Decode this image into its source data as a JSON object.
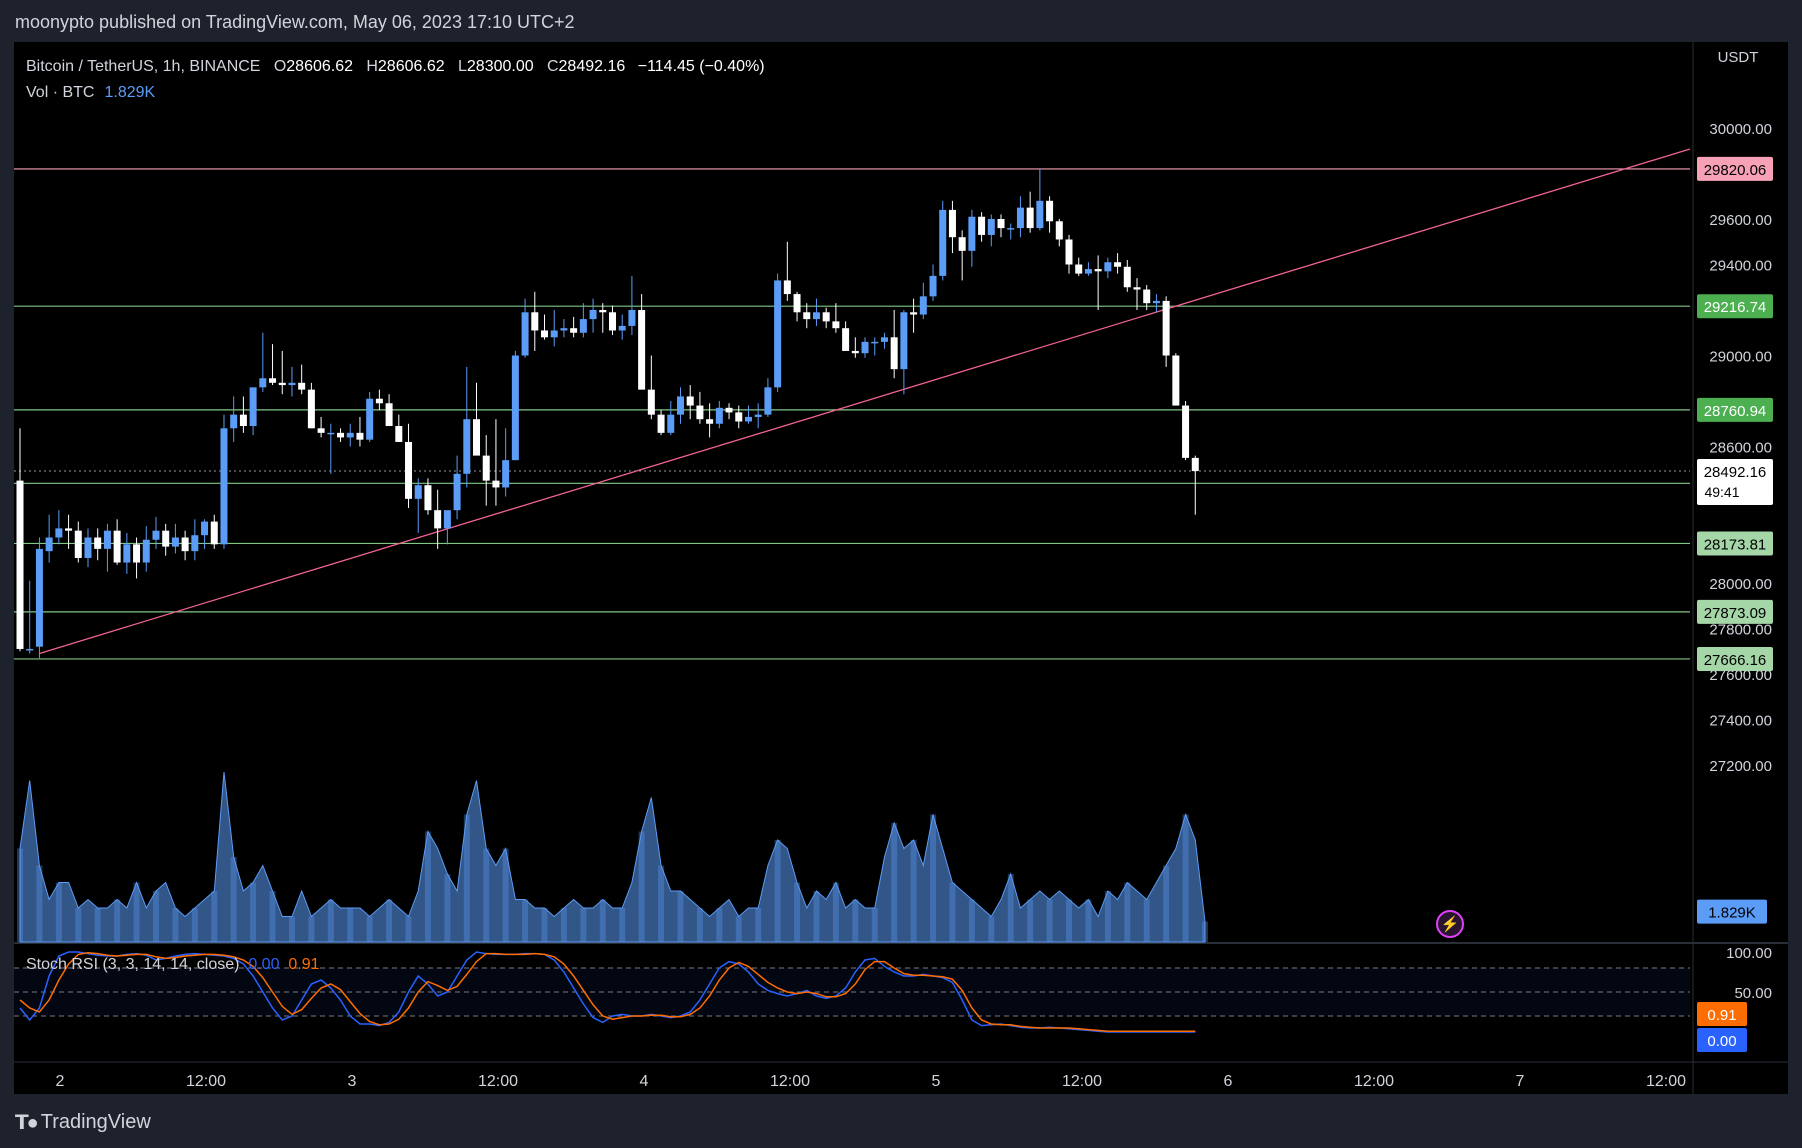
{
  "header": {
    "publisher_line": "moonypto published on TradingView.com, May 06, 2023 17:10 UTC+2"
  },
  "legend": {
    "symbol": "Bitcoin / TetherUS, 1h, BINANCE",
    "open_label": "O",
    "open": "28606.62",
    "high_label": "H",
    "high": "28606.62",
    "low_label": "L",
    "low": "28300.00",
    "close_label": "C",
    "close": "28492.16",
    "change": "−114.45 (−0.40%)",
    "volume_label": "Vol · BTC",
    "volume": "1.829K"
  },
  "stoch_rsi": {
    "label": "Stoch RSI (3, 3, 14, 14, close)",
    "k": "0.00",
    "d": "0.91"
  },
  "footer": {
    "brand": "TradingView"
  },
  "colors": {
    "up": "#5b9cf6",
    "down": "#ffffff",
    "volume": "#5b9cf6",
    "resistance": "#f7a1b6",
    "support": "#81c784",
    "trendline": "#f06292",
    "k_line": "#2962ff",
    "d_line": "#ff6d00"
  },
  "chart_data": [
    {
      "type": "candlestick",
      "y_axis_unit": "USDT",
      "y_ticks": [
        30000,
        29600,
        29400,
        29000,
        28600,
        28000,
        27800,
        27600,
        27400,
        27200
      ],
      "ylim": [
        27000,
        30100
      ],
      "x_ticks": [
        "2",
        "12:00",
        "3",
        "12:00",
        "4",
        "12:00",
        "5",
        "12:00",
        "6",
        "12:00",
        "7",
        "12:00"
      ],
      "candles_ohlc": [
        [
          28450,
          28680,
          27700,
          27710
        ],
        [
          27710,
          28010,
          27690,
          27710
        ],
        [
          27720,
          28200,
          27670,
          28150
        ],
        [
          28140,
          28300,
          28090,
          28200
        ],
        [
          28200,
          28320,
          28170,
          28240
        ],
        [
          28240,
          28300,
          28150,
          28230
        ],
        [
          28230,
          28270,
          28090,
          28110
        ],
        [
          28110,
          28240,
          28070,
          28200
        ],
        [
          28200,
          28240,
          28100,
          28150
        ],
        [
          28150,
          28260,
          28050,
          28230
        ],
        [
          28230,
          28280,
          28080,
          28090
        ],
        [
          28090,
          28220,
          28040,
          28170
        ],
        [
          28170,
          28200,
          28020,
          28090
        ],
        [
          28090,
          28250,
          28050,
          28190
        ],
        [
          28190,
          28290,
          28150,
          28230
        ],
        [
          28230,
          28260,
          28120,
          28160
        ],
        [
          28160,
          28260,
          28130,
          28200
        ],
        [
          28200,
          28230,
          28100,
          28140
        ],
        [
          28140,
          28280,
          28100,
          28210
        ],
        [
          28210,
          28280,
          28150,
          28270
        ],
        [
          28270,
          28300,
          28150,
          28170
        ],
        [
          28170,
          28740,
          28150,
          28680
        ],
        [
          28680,
          28820,
          28620,
          28740
        ],
        [
          28740,
          28820,
          28660,
          28690
        ],
        [
          28690,
          28840,
          28650,
          28860
        ],
        [
          28860,
          29100,
          28840,
          28900
        ],
        [
          28900,
          29050,
          28870,
          28880
        ],
        [
          28880,
          29020,
          28830,
          28870
        ],
        [
          28870,
          28950,
          28820,
          28880
        ],
        [
          28880,
          28960,
          28830,
          28850
        ],
        [
          28850,
          28880,
          28680,
          28680
        ],
        [
          28680,
          28730,
          28640,
          28660
        ],
        [
          28660,
          28700,
          28480,
          28660
        ],
        [
          28660,
          28680,
          28620,
          28640
        ],
        [
          28640,
          28700,
          28600,
          28660
        ],
        [
          28660,
          28730,
          28600,
          28630
        ],
        [
          28630,
          28840,
          28620,
          28810
        ],
        [
          28810,
          28850,
          28760,
          28790
        ],
        [
          28790,
          28830,
          28700,
          28690
        ],
        [
          28690,
          28740,
          28650,
          28620
        ],
        [
          28620,
          28700,
          28330,
          28370
        ],
        [
          28370,
          28460,
          28220,
          28430
        ],
        [
          28430,
          28460,
          28300,
          28320
        ],
        [
          28320,
          28410,
          28150,
          28240
        ],
        [
          28240,
          28300,
          28170,
          28320
        ],
        [
          28320,
          28560,
          28280,
          28480
        ],
        [
          28480,
          28950,
          28420,
          28720
        ],
        [
          28720,
          28880,
          28620,
          28560
        ],
        [
          28560,
          28650,
          28340,
          28450
        ],
        [
          28450,
          28720,
          28340,
          28420
        ],
        [
          28420,
          28680,
          28380,
          28540
        ],
        [
          28540,
          29020,
          28540,
          29000
        ],
        [
          29000,
          29250,
          28990,
          29190
        ],
        [
          29190,
          29280,
          29020,
          29110
        ],
        [
          29110,
          29180,
          29070,
          29080
        ],
        [
          29080,
          29200,
          29040,
          29110
        ],
        [
          29110,
          29160,
          29080,
          29120
        ],
        [
          29120,
          29170,
          29080,
          29100
        ],
        [
          29100,
          29230,
          29080,
          29160
        ],
        [
          29160,
          29250,
          29100,
          29200
        ],
        [
          29200,
          29230,
          29100,
          29190
        ],
        [
          29190,
          29220,
          29090,
          29110
        ],
        [
          29110,
          29180,
          29070,
          29130
        ],
        [
          29130,
          29350,
          29090,
          29200
        ],
        [
          29200,
          29270,
          29050,
          28850
        ],
        [
          28850,
          29000,
          28720,
          28740
        ],
        [
          28740,
          28760,
          28650,
          28660
        ],
        [
          28660,
          28800,
          28650,
          28740
        ],
        [
          28740,
          28860,
          28700,
          28820
        ],
        [
          28820,
          28870,
          28720,
          28780
        ],
        [
          28780,
          28840,
          28700,
          28720
        ],
        [
          28720,
          28790,
          28640,
          28700
        ],
        [
          28700,
          28800,
          28680,
          28770
        ],
        [
          28770,
          28790,
          28720,
          28750
        ],
        [
          28750,
          28780,
          28680,
          28710
        ],
        [
          28710,
          28780,
          28700,
          28730
        ],
        [
          28730,
          28790,
          28680,
          28740
        ],
        [
          28740,
          28900,
          28730,
          28860
        ],
        [
          28860,
          29360,
          28840,
          29330
        ],
        [
          29330,
          29500,
          29240,
          29270
        ],
        [
          29270,
          29280,
          29150,
          29190
        ],
        [
          29190,
          29230,
          29120,
          29160
        ],
        [
          29160,
          29250,
          29130,
          29190
        ],
        [
          29190,
          29210,
          29120,
          29150
        ],
        [
          29150,
          29230,
          29100,
          29120
        ],
        [
          29120,
          29150,
          29030,
          29020
        ],
        [
          29020,
          29080,
          28990,
          29010
        ],
        [
          29010,
          29080,
          28990,
          29060
        ],
        [
          29060,
          29080,
          29000,
          29060
        ],
        [
          29060,
          29100,
          29030,
          29080
        ],
        [
          29080,
          29200,
          28900,
          28940
        ],
        [
          28940,
          29200,
          28830,
          29190
        ],
        [
          29190,
          29250,
          29100,
          29180
        ],
        [
          29180,
          29320,
          29160,
          29260
        ],
        [
          29260,
          29400,
          29240,
          29350
        ],
        [
          29350,
          29680,
          29330,
          29640
        ],
        [
          29640,
          29680,
          29450,
          29520
        ],
        [
          29520,
          29550,
          29330,
          29460
        ],
        [
          29460,
          29640,
          29390,
          29610
        ],
        [
          29610,
          29630,
          29500,
          29530
        ],
        [
          29530,
          29620,
          29480,
          29600
        ],
        [
          29600,
          29620,
          29520,
          29560
        ],
        [
          29560,
          29580,
          29510,
          29560
        ],
        [
          29560,
          29700,
          29520,
          29650
        ],
        [
          29650,
          29720,
          29540,
          29560
        ],
        [
          29560,
          29820,
          29550,
          29680
        ],
        [
          29680,
          29700,
          29540,
          29590
        ],
        [
          29590,
          29600,
          29480,
          29510
        ],
        [
          29510,
          29530,
          29360,
          29400
        ],
        [
          29400,
          29430,
          29350,
          29360
        ],
        [
          29360,
          29410,
          29350,
          29380
        ],
        [
          29380,
          29440,
          29200,
          29370
        ],
        [
          29370,
          29430,
          29340,
          29410
        ],
        [
          29410,
          29450,
          29360,
          29390
        ],
        [
          29390,
          29420,
          29280,
          29300
        ],
        [
          29300,
          29340,
          29200,
          29290
        ],
        [
          29290,
          29310,
          29200,
          29230
        ],
        [
          29230,
          29270,
          29190,
          29240
        ],
        [
          29240,
          29260,
          28950,
          29000
        ],
        [
          29000,
          29010,
          28780,
          28780
        ],
        [
          28780,
          28800,
          28540,
          28550
        ],
        [
          28550,
          28560,
          28300,
          28492
        ]
      ],
      "volume": [
        0.55,
        0.95,
        0.45,
        0.25,
        0.35,
        0.35,
        0.2,
        0.25,
        0.2,
        0.2,
        0.25,
        0.2,
        0.35,
        0.2,
        0.3,
        0.35,
        0.2,
        0.15,
        0.2,
        0.25,
        0.3,
        1.0,
        0.5,
        0.3,
        0.35,
        0.45,
        0.3,
        0.15,
        0.15,
        0.3,
        0.15,
        0.2,
        0.25,
        0.2,
        0.2,
        0.2,
        0.15,
        0.2,
        0.25,
        0.2,
        0.15,
        0.3,
        0.65,
        0.55,
        0.4,
        0.3,
        0.75,
        0.95,
        0.55,
        0.45,
        0.55,
        0.25,
        0.25,
        0.2,
        0.2,
        0.15,
        0.2,
        0.25,
        0.2,
        0.2,
        0.25,
        0.2,
        0.2,
        0.35,
        0.65,
        0.85,
        0.45,
        0.3,
        0.3,
        0.25,
        0.2,
        0.15,
        0.2,
        0.25,
        0.15,
        0.2,
        0.2,
        0.45,
        0.6,
        0.55,
        0.35,
        0.2,
        0.3,
        0.25,
        0.35,
        0.2,
        0.25,
        0.2,
        0.2,
        0.5,
        0.7,
        0.55,
        0.6,
        0.45,
        0.75,
        0.55,
        0.35,
        0.3,
        0.25,
        0.2,
        0.15,
        0.25,
        0.4,
        0.2,
        0.25,
        0.3,
        0.25,
        0.3,
        0.25,
        0.2,
        0.25,
        0.15,
        0.3,
        0.25,
        0.35,
        0.3,
        0.25,
        0.35,
        0.45,
        0.55,
        0.75,
        0.6,
        0.12
      ],
      "levels": [
        {
          "label": "29820.06",
          "value": 29820.06,
          "kind": "resistance"
        },
        {
          "label": "29216.74",
          "value": 29216.74,
          "kind": "support"
        },
        {
          "label": "28760.94",
          "value": 28760.94,
          "kind": "support"
        },
        {
          "label": "28438.25",
          "value": 28438.25,
          "kind": "support"
        },
        {
          "label": "28173.81",
          "value": 28173.81,
          "kind": "support"
        },
        {
          "label": "27873.09",
          "value": 27873.09,
          "kind": "support"
        },
        {
          "label": "27666.16",
          "value": 27666.16,
          "kind": "support"
        }
      ],
      "current_price": {
        "label": "28492.16",
        "value": 28492.16,
        "countdown": "49:41"
      },
      "volume_last_label": "1.829K",
      "trendline": {
        "start_index": 2,
        "start_value": 27690,
        "end_index": 120,
        "end_value": 29230
      }
    },
    {
      "type": "line",
      "title": "Stoch RSI (3, 3, 14, 14, close)",
      "ylim": [
        0,
        100
      ],
      "y_ticks": [
        "100.00",
        "50.00"
      ],
      "bands": [
        80,
        50,
        20
      ],
      "k_label": "0.00",
      "d_label": "0.91",
      "series": [
        {
          "name": "K",
          "values": [
            30,
            15,
            30,
            70,
            95,
            100,
            100,
            98,
            96,
            95,
            95,
            97,
            98,
            96,
            90,
            92,
            95,
            97,
            98,
            97,
            96,
            95,
            92,
            85,
            70,
            50,
            30,
            15,
            20,
            40,
            60,
            65,
            55,
            40,
            20,
            10,
            10,
            8,
            12,
            25,
            50,
            70,
            60,
            45,
            50,
            70,
            90,
            100,
            98,
            97,
            97,
            97,
            98,
            98,
            97,
            90,
            75,
            55,
            35,
            18,
            12,
            20,
            22,
            20,
            20,
            22,
            20,
            18,
            20,
            25,
            40,
            60,
            80,
            88,
            85,
            75,
            60,
            52,
            48,
            45,
            48,
            52,
            45,
            42,
            45,
            55,
            75,
            90,
            92,
            82,
            75,
            70,
            70,
            72,
            70,
            68,
            62,
            40,
            15,
            8,
            9,
            10,
            8,
            6,
            5,
            5,
            6,
            5,
            4,
            3,
            2,
            1,
            0,
            0,
            0,
            0,
            0,
            0,
            0,
            0,
            0,
            0
          ]
        },
        {
          "name": "D",
          "values": [
            40,
            30,
            25,
            40,
            65,
            85,
            97,
            99,
            98,
            96,
            95,
            96,
            97,
            97,
            94,
            92,
            93,
            95,
            96,
            97,
            97,
            96,
            94,
            90,
            82,
            68,
            50,
            32,
            22,
            28,
            42,
            55,
            60,
            53,
            38,
            23,
            13,
            9,
            10,
            16,
            30,
            50,
            63,
            58,
            52,
            57,
            72,
            88,
            98,
            98,
            97,
            97,
            97,
            98,
            97,
            94,
            85,
            70,
            52,
            34,
            20,
            16,
            18,
            20,
            20,
            21,
            21,
            19,
            19,
            22,
            30,
            45,
            65,
            80,
            87,
            82,
            72,
            62,
            55,
            50,
            48,
            50,
            48,
            44,
            44,
            48,
            60,
            78,
            88,
            88,
            80,
            73,
            71,
            71,
            70,
            69,
            66,
            52,
            30,
            15,
            10,
            9,
            9,
            7,
            6,
            5,
            5,
            5,
            5,
            4,
            3,
            2,
            1,
            1,
            1,
            1,
            1,
            1,
            1,
            1,
            1,
            1
          ]
        }
      ]
    }
  ]
}
